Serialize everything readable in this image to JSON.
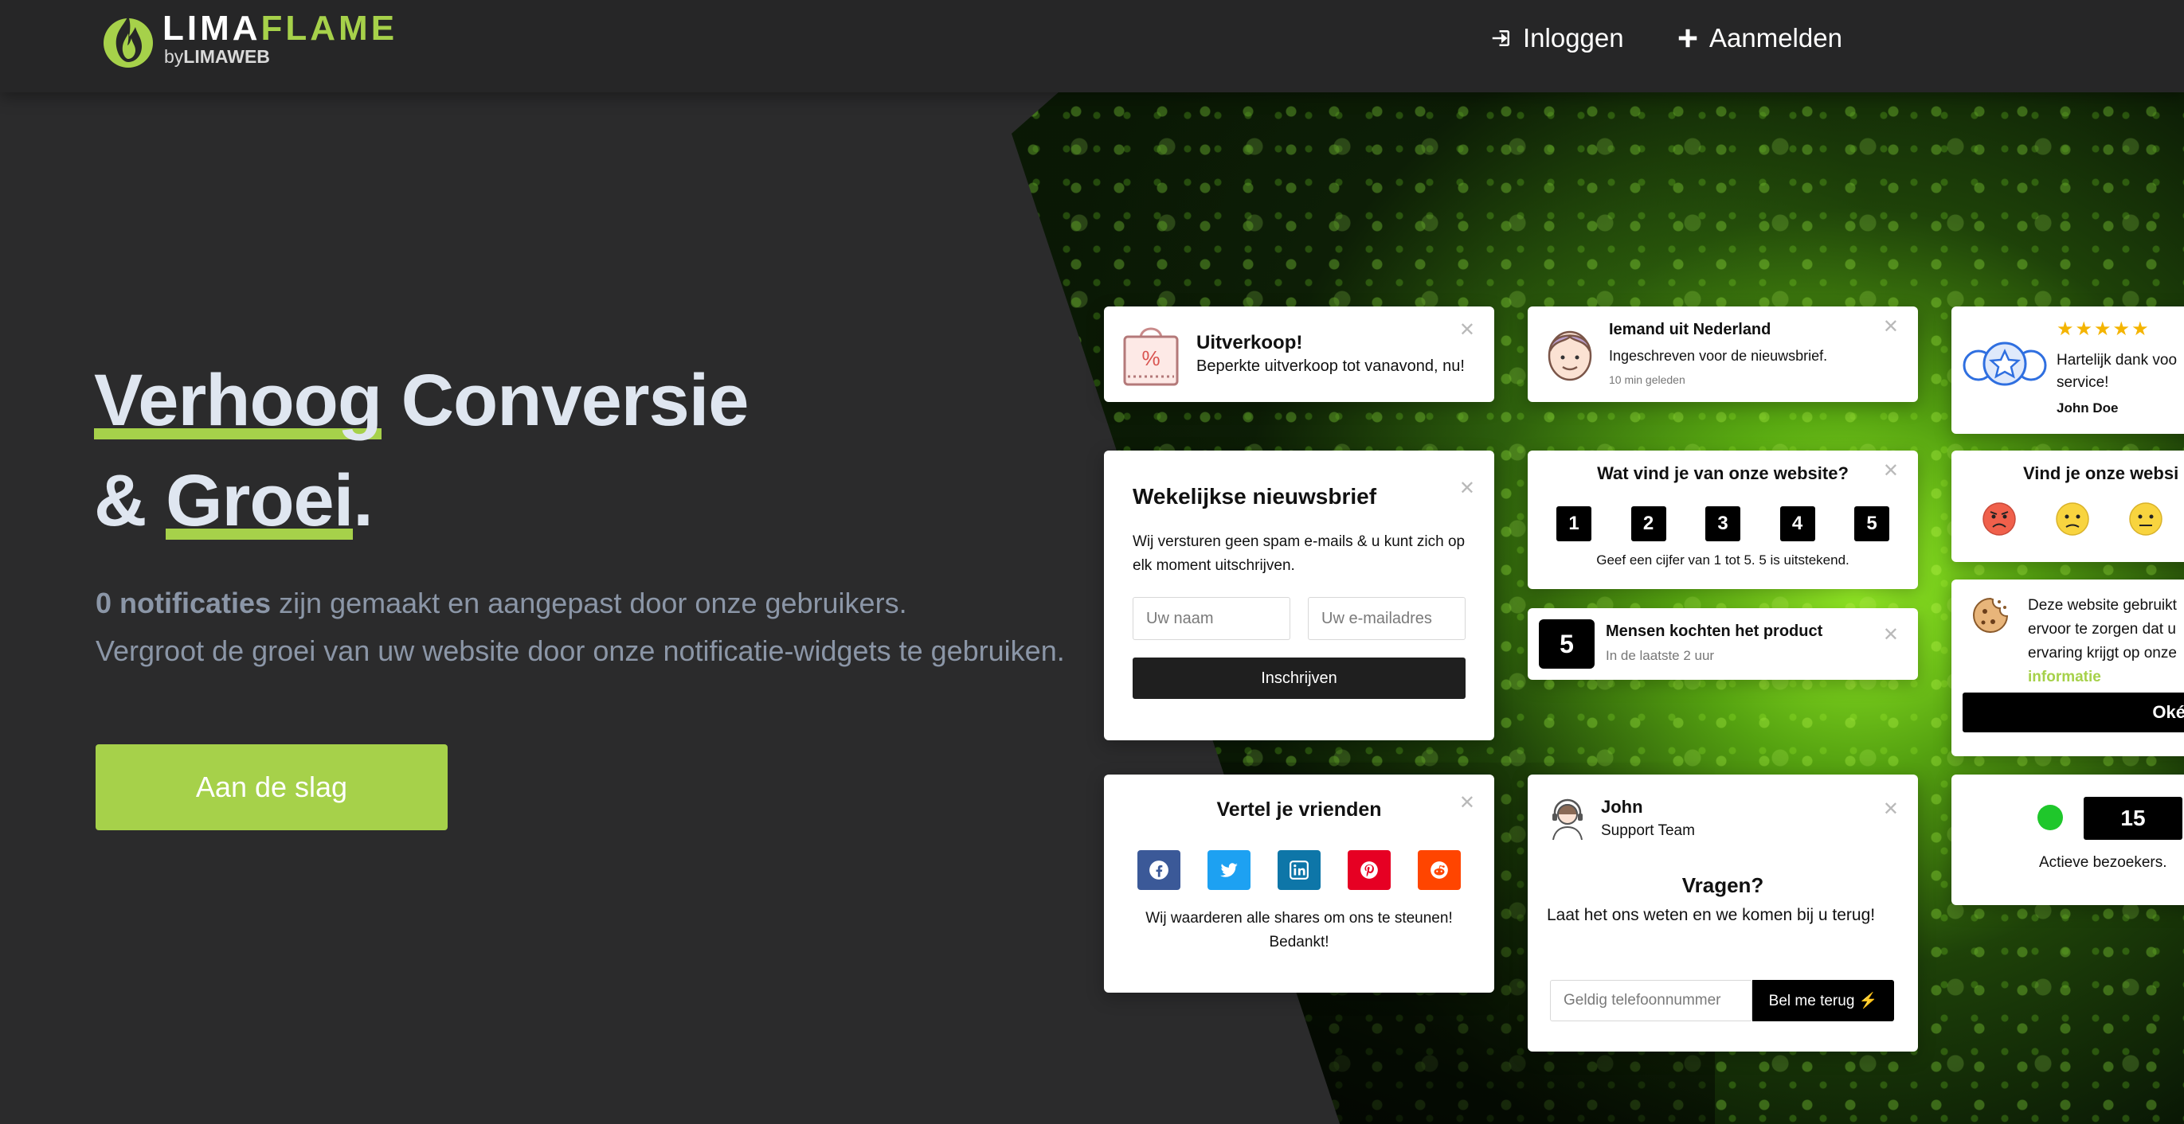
{
  "brand": {
    "name_part1": "LIMA",
    "name_part2": "FLAME",
    "sub_by": "by",
    "sub_company": "LIMAWEB"
  },
  "nav": {
    "login_label": "Inloggen",
    "register_label": "Aanmelden"
  },
  "hero": {
    "title_word1": "Verhoog",
    "title_word2": " Conversie",
    "title_amp": "& ",
    "title_word3": "Groei",
    "title_dot": ".",
    "count_bold": "0 notificaties",
    "line1_rest": " zijn gemaakt en aangepast door onze gebruikers.",
    "line2": "Vergroot de groei van uw website door onze notificatie-widgets te gebruiken.",
    "cta_label": "Aan de slag"
  },
  "cards": {
    "sale": {
      "title": "Uitverkoop!",
      "text": "Beperkte uitverkoop tot vanavond, nu!",
      "icon_glyph": "%"
    },
    "signup": {
      "title": "Iemand uit Nederland",
      "text": "Ingeschreven voor de nieuwsbrief.",
      "time": "10 min geleden"
    },
    "review": {
      "stars": "★★★★★",
      "text_line1": "Hartelijk dank voo",
      "text_line2": "service!",
      "author": "John Doe"
    },
    "newsletter": {
      "title": "Wekelijkse nieuwsbrief",
      "text": "Wij versturen geen spam e-mails & u kunt zich op elk moment uitschrijven.",
      "name_placeholder": "Uw naam",
      "email_placeholder": "Uw e-mailadres",
      "button_label": "Inschrijven"
    },
    "rating": {
      "title": "Wat vind je van onze website?",
      "options": [
        "1",
        "2",
        "3",
        "4",
        "5"
      ],
      "hint": "Geef een cijfer van 1 tot 5. 5 is uitstekend."
    },
    "emoji": {
      "title": "Vind je onze websi"
    },
    "purchases": {
      "count": "5",
      "title": "Mensen kochten het product",
      "sub": "In de laatste 2 uur"
    },
    "cookie": {
      "line1": "Deze website gebruikt",
      "line2": "ervoor te zorgen dat u",
      "line3": "ervaring krijgt op onze",
      "link": "informatie",
      "button_label": "Oké"
    },
    "share": {
      "title": "Vertel je vrienden",
      "text": "Wij waarderen alle shares om ons te steunen! Bedankt!"
    },
    "callback": {
      "name": "John",
      "role": "Support Team",
      "title": "Vragen?",
      "text": "Laat het ons weten en we komen bij u terug!",
      "phone_placeholder": "Geldig telefoonnummer",
      "button_label": "Bel me terug ⚡"
    },
    "active": {
      "count": "15",
      "label": "Actieve bezoekers."
    }
  },
  "colors": {
    "accent": "#a6d14a",
    "facebook": "#3b5998",
    "twitter": "#1da1f2",
    "linkedin": "#0e76a8",
    "pinterest": "#e60023",
    "reddit": "#ff4500",
    "active_dot": "#1fc72b",
    "star": "#f4b400"
  }
}
